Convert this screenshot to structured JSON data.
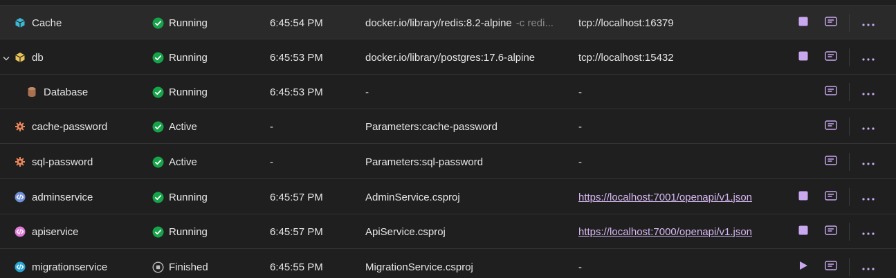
{
  "colors": {
    "running_green": "#16a34a",
    "finished_gray": "#bdbdbd",
    "action_purple": "#c9a8f0",
    "link_purple": "#d7b8f3",
    "container_teal": "#3db8d1",
    "container_yellow": "#e8c35a",
    "database_brown": "#c08a64",
    "param_orange": "#e8855a",
    "project_blue": "#6f8fd8",
    "project_pink": "#e07ad8",
    "project_cyan": "#2aa6d6"
  },
  "rows": [
    {
      "name": "Cache",
      "icon": "container-icon",
      "state": "Running",
      "state_icon": "check-circle-icon",
      "time": "6:45:54 PM",
      "source": "docker.io/library/redis:8.2-alpine",
      "args": "-c redi...",
      "url": "tcp://localhost:16379",
      "url_link": false,
      "action": "stop-icon"
    },
    {
      "name": "db",
      "icon": "container-icon",
      "expandable": true,
      "state": "Running",
      "state_icon": "check-circle-icon",
      "time": "6:45:53 PM",
      "source": "docker.io/library/postgres:17.6-alpine",
      "url": "tcp://localhost:15432",
      "url_link": false,
      "action": "stop-icon"
    },
    {
      "name": "Database",
      "icon": "database-icon",
      "child": true,
      "state": "Running",
      "state_icon": "check-circle-icon",
      "time": "6:45:53 PM",
      "source": "-",
      "url": "-",
      "url_link": false
    },
    {
      "name": "cache-password",
      "icon": "parameter-icon",
      "state": "Active",
      "state_icon": "check-circle-icon",
      "time": "-",
      "source": "Parameters:cache-password",
      "url": "-",
      "url_link": false
    },
    {
      "name": "sql-password",
      "icon": "parameter-icon",
      "state": "Active",
      "state_icon": "check-circle-icon",
      "time": "-",
      "source": "Parameters:sql-password",
      "url": "-",
      "url_link": false
    },
    {
      "name": "adminservice",
      "icon": "project-icon",
      "state": "Running",
      "state_icon": "check-circle-icon",
      "time": "6:45:57 PM",
      "source": "AdminService.csproj",
      "url": "https://localhost:7001/openapi/v1.json",
      "url_link": true,
      "action": "stop-icon"
    },
    {
      "name": "apiservice",
      "icon": "project-icon",
      "state": "Running",
      "state_icon": "check-circle-icon",
      "time": "6:45:57 PM",
      "source": "ApiService.csproj",
      "url": "https://localhost:7000/openapi/v1.json",
      "url_link": true,
      "action": "stop-icon"
    },
    {
      "name": "migrationservice",
      "icon": "project-icon",
      "state": "Finished",
      "state_icon": "stopped-circle-icon",
      "time": "6:45:55 PM",
      "source": "MigrationService.csproj",
      "url": "-",
      "url_link": false,
      "action": "play-icon"
    }
  ]
}
